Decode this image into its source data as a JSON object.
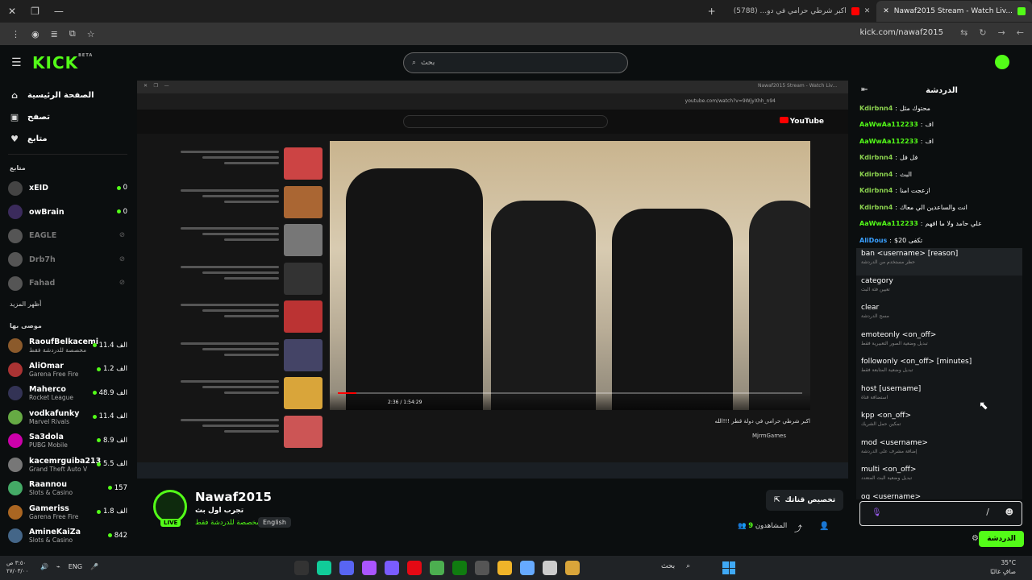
{
  "browser": {
    "tabs": [
      {
        "title": "اكبر شرطي حرامي في دو... (5788)",
        "active": false,
        "fav": "#ff0000"
      },
      {
        "title": "Nawaf2015 Stream - Watch Liv...",
        "active": true,
        "fav": "#53fc18"
      }
    ],
    "url": "kick.com/nawaf2015"
  },
  "kick": {
    "logo": "KICK",
    "logo_badge": "BETA",
    "search_placeholder": "بحث"
  },
  "sidebar": {
    "nav": [
      {
        "label": "الصفحة الرئيسية",
        "icon": "⌂"
      },
      {
        "label": "تصفح",
        "icon": "▣"
      },
      {
        "label": "متابع",
        "icon": "♥"
      }
    ],
    "following_title": "متابع",
    "following": [
      {
        "name": "xEID",
        "count": "0",
        "online": true,
        "color": "#444"
      },
      {
        "name": "owBrain",
        "count": "0",
        "online": true,
        "color": "#3b2b5c"
      },
      {
        "name": "EAGLE",
        "count": "",
        "online": false,
        "color": "#555"
      },
      {
        "name": "Drb7h",
        "count": "",
        "online": false,
        "color": "#555"
      },
      {
        "name": "Fahad",
        "count": "",
        "online": false,
        "color": "#555"
      }
    ],
    "show_more": "أظهر المزيد",
    "recommended_title": "موصى بها",
    "recommended": [
      {
        "name": "RaoufBelkacemi",
        "sub": "مخصصة للدردشة فقط",
        "count": "11.4 الف",
        "color": "#8b5a2b"
      },
      {
        "name": "AliOmar",
        "sub": "Garena Free Fire",
        "count": "1.2 الف",
        "color": "#a33"
      },
      {
        "name": "Maherco",
        "sub": "Rocket League",
        "count": "48.9 الف",
        "color": "#335"
      },
      {
        "name": "vodkafunky",
        "sub": "Marvel Rivals",
        "count": "11.4 الف",
        "color": "#6a4"
      },
      {
        "name": "Sa3dola",
        "sub": "PUBG Mobile",
        "count": "8.9 الف",
        "color": "#c0a"
      },
      {
        "name": "kacemrguiba213",
        "sub": "Grand Theft Auto V",
        "count": "5.5 الف",
        "color": "#777"
      },
      {
        "name": "Raannou",
        "sub": "Slots & Casino",
        "count": "157",
        "color": "#4a6"
      },
      {
        "name": "Gameriss",
        "sub": "Garena Free Fire",
        "count": "1.8 الف",
        "color": "#a62"
      },
      {
        "name": "AmineKaiZa",
        "sub": "Slots & Casino",
        "count": "842",
        "color": "#468"
      }
    ]
  },
  "stream": {
    "inner_url": "youtube.com/watch?v=9WjyXhh_n94",
    "inner_time": "2:36 / 1:54:29",
    "inner_title": "اكبر شرطي حرامي في دولة قطر !!!الله",
    "inner_channel": "MjrmGames"
  },
  "info": {
    "channel": "Nawaf2015",
    "title": "تجرب اول بث",
    "category": "مخصصة للدردشة فقط",
    "language": "English",
    "customize": "تخصيص قناتك",
    "viewers_label": "المشاهدون",
    "viewers": "9"
  },
  "chat": {
    "title": "الدردشة",
    "messages": [
      {
        "user": "Kdirbnn4",
        "text": "محتوك مثل",
        "color": "#8bd14f"
      },
      {
        "user": "AaWwAa112233",
        "text": "اف",
        "color": "#53fc18"
      },
      {
        "user": "AaWwAa112233",
        "text": "اف",
        "color": "#53fc18"
      },
      {
        "user": "Kdirbnn4",
        "text": "فل فل",
        "color": "#8bd14f"
      },
      {
        "user": "Kdirbnn4",
        "text": "البث",
        "color": "#8bd14f"
      },
      {
        "user": "Kdirbnn4",
        "text": "ازعجت امنا",
        "color": "#8bd14f"
      },
      {
        "user": "Kdirbnn4",
        "text": "انت والساعدين الي معاك",
        "color": "#8bd14f"
      },
      {
        "user": "AaWwAa112233",
        "text": "علي حامد ولا ما افهم",
        "color": "#53fc18"
      },
      {
        "user": "AliDous",
        "text": "$20 تكفى",
        "color": "#3aa0ff"
      }
    ],
    "commands": [
      {
        "name": "ban <username> [reason]",
        "desc": "حظر مستخدم من الدردشة"
      },
      {
        "name": "category",
        "desc": "تعيين فئة البث"
      },
      {
        "name": "clear",
        "desc": "مسح الدردشة"
      },
      {
        "name": "emoteonly <on_off>",
        "desc": "تبديل وضعية الصور التعبيرية فقط"
      },
      {
        "name": "followonly <on_off> [minutes]",
        "desc": "تبديل وضعية المتابعة فقط"
      },
      {
        "name": "host [username]",
        "desc": "استضافة قناة"
      },
      {
        "name": "kpp <on_off>",
        "desc": "تمكين حمل الشريك"
      },
      {
        "name": "mod <username>",
        "desc": "إضافة مشرف على الدردشة"
      },
      {
        "name": "multi <on_off>",
        "desc": "تبديل وضعية البث المتعدد"
      },
      {
        "name": "og <username>",
        "desc": ""
      }
    ],
    "input_value": "/",
    "send_label": "الدردشة"
  },
  "taskbar": {
    "time": "٣:٥٠ ص",
    "date": "٢٧/٠٣/٠٠",
    "lang": "ENG",
    "search_label": "بحث",
    "weather_temp": "35°C",
    "weather_desc": "صافٍ غالبًا"
  }
}
